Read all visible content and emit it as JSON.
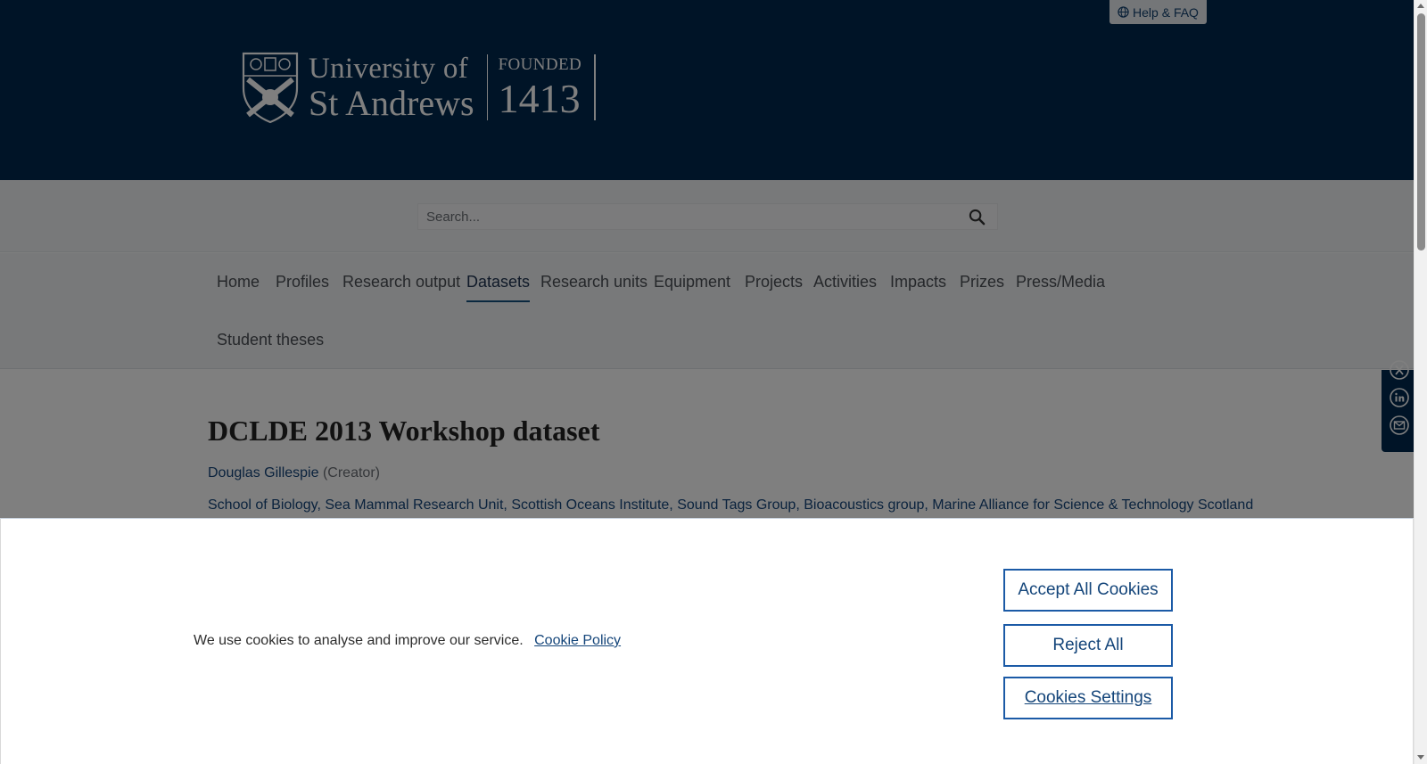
{
  "header": {
    "logo": {
      "line1": "University of",
      "line2": "St Andrews",
      "founded_label": "FOUNDED",
      "founded_year": "1413"
    },
    "help_label": "Help & FAQ"
  },
  "search": {
    "placeholder": "Search..."
  },
  "nav": {
    "items": [
      {
        "label": "Home"
      },
      {
        "label": "Profiles"
      },
      {
        "label": "Research output"
      },
      {
        "label": "Datasets",
        "active": true
      },
      {
        "label": "Research units"
      },
      {
        "label": "Equipment"
      },
      {
        "label": "Projects"
      },
      {
        "label": "Activities"
      },
      {
        "label": "Impacts"
      },
      {
        "label": "Prizes"
      },
      {
        "label": "Press/Media"
      },
      {
        "label": "Student theses"
      }
    ]
  },
  "dataset": {
    "title": "DCLDE 2013 Workshop dataset",
    "creator_name": "Douglas Gillespie",
    "creator_role": "(Creator)",
    "units": [
      "School of Biology",
      "Sea Mammal Research Unit",
      "Scottish Oceans Institute",
      "Sound Tags Group",
      "Bioacoustics group",
      "Marine Alliance for Science & Technology Scotland"
    ]
  },
  "share": {
    "icons": [
      "x-twitter-icon",
      "linkedin-icon",
      "email-icon"
    ]
  },
  "cookie_banner": {
    "text": "We use cookies to analyse and improve our service.",
    "policy_link": "Cookie Policy",
    "accept_label": "Accept All Cookies",
    "reject_label": "Reject All",
    "settings_label": "Cookies Settings"
  },
  "colors": {
    "header_bg": "#00294f",
    "link": "#14457a",
    "button_border": "#1b5aa6"
  }
}
